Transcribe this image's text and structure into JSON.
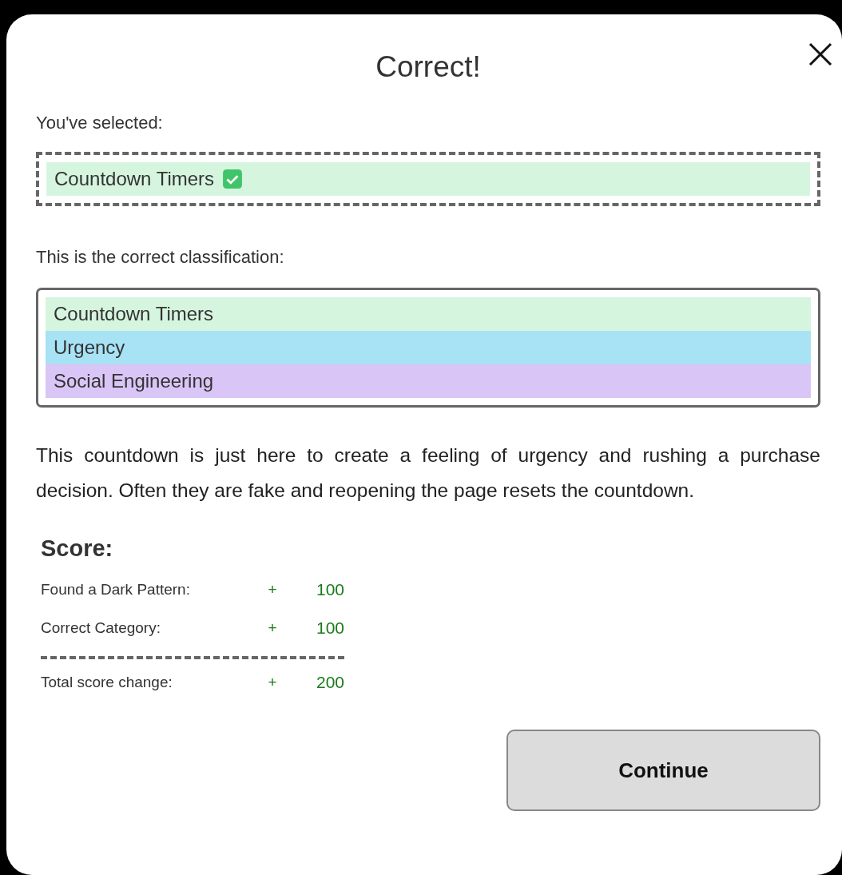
{
  "dialog": {
    "title": "Correct!"
  },
  "selection": {
    "label": "You've selected:",
    "items": [
      {
        "text": "Countdown Timers",
        "correct": true,
        "color": "#d6f5df"
      }
    ]
  },
  "classification": {
    "label": "This is the correct classification:",
    "items": [
      {
        "text": "Countdown Timers",
        "color": "#d6f5df"
      },
      {
        "text": "Urgency",
        "color": "#a8e2f5"
      },
      {
        "text": "Social Engineering",
        "color": "#dac5f7"
      }
    ]
  },
  "explanation": "This countdown is just here to create a feeling of urgency and rushing a purchase decision. Often they are fake and reopening the page resets the countdown.",
  "score": {
    "title": "Score:",
    "rows": [
      {
        "label": "Found a Dark Pattern:",
        "sign": "+",
        "points": "100"
      },
      {
        "label": "Correct Category:",
        "sign": "+",
        "points": "100"
      }
    ],
    "total": {
      "label": "Total score change:",
      "sign": "+",
      "points": "200"
    }
  },
  "buttons": [
    {
      "label": "Continue"
    }
  ]
}
